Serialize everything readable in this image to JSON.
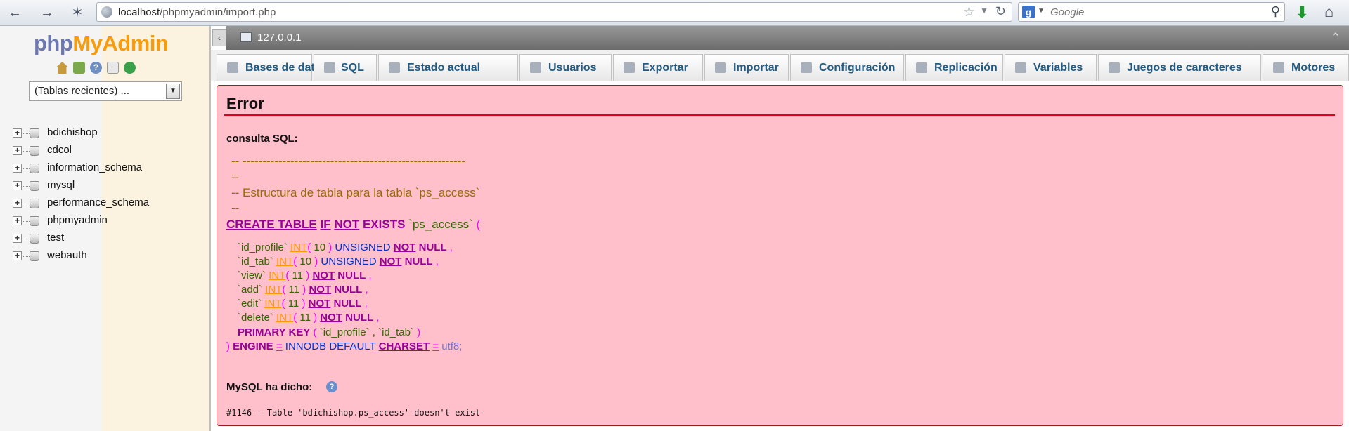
{
  "browser": {
    "url_host": "localhost",
    "url_path": "/phpmyadmin/import.php",
    "search_placeholder": "Google"
  },
  "nav": {
    "logo_php": "php",
    "logo_myadmin": "MyAdmin",
    "recent_tables": "(Tablas recientes) ...",
    "databases": [
      "bdichishop",
      "cdcol",
      "information_schema",
      "mysql",
      "performance_schema",
      "phpmyadmin",
      "test",
      "webauth"
    ]
  },
  "server": {
    "label": "127.0.0.1"
  },
  "menu": {
    "tabs": [
      {
        "label": "Bases de datos",
        "icon": "databases-icon"
      },
      {
        "label": "SQL",
        "icon": "sql-icon"
      },
      {
        "label": "Estado actual",
        "icon": "status-icon"
      },
      {
        "label": "Usuarios",
        "icon": "users-icon"
      },
      {
        "label": "Exportar",
        "icon": "export-icon"
      },
      {
        "label": "Importar",
        "icon": "import-icon"
      },
      {
        "label": "Configuración",
        "icon": "wrench-icon"
      },
      {
        "label": "Replicación",
        "icon": "replication-icon"
      },
      {
        "label": "Variables",
        "icon": "variables-icon"
      },
      {
        "label": "Juegos de caracteres",
        "icon": "charset-icon"
      },
      {
        "label": "Motores",
        "icon": "engines-icon"
      }
    ]
  },
  "error": {
    "title": "Error",
    "query_label": "consulta SQL:",
    "comment_lines": [
      "-- --------------------------------------------------------",
      "--",
      "-- Estructura de tabla para la tabla `ps_access`",
      "--"
    ],
    "create_kw": "CREATE TABLE",
    "if_kw": "IF",
    "not_kw": "NOT",
    "exists_kw": "EXISTS",
    "table_name": "`ps_access`",
    "columns": [
      {
        "name": "`id_profile`",
        "type": "INT",
        "size": "10",
        "extra": "UNSIGNED"
      },
      {
        "name": "`id_tab`",
        "type": "INT",
        "size": "10",
        "extra": "UNSIGNED"
      },
      {
        "name": "`view`",
        "type": "INT",
        "size": "11",
        "extra": ""
      },
      {
        "name": "`add`",
        "type": "INT",
        "size": "11",
        "extra": ""
      },
      {
        "name": "`edit`",
        "type": "INT",
        "size": "11",
        "extra": ""
      },
      {
        "name": "`delete`",
        "type": "INT",
        "size": "11",
        "extra": ""
      }
    ],
    "primary_key": "PRIMARY KEY",
    "pk_cols": "`id_profile` , `id_tab`",
    "engine_kw": "ENGINE",
    "engine_val": "INNODB",
    "default_kw": "DEFAULT",
    "charset_kw": "CHARSET",
    "charset_val": "utf8;",
    "mysql_said": "MySQL ha dicho:",
    "message": "#1146 - Table 'bdichishop.ps_access' doesn't exist"
  }
}
